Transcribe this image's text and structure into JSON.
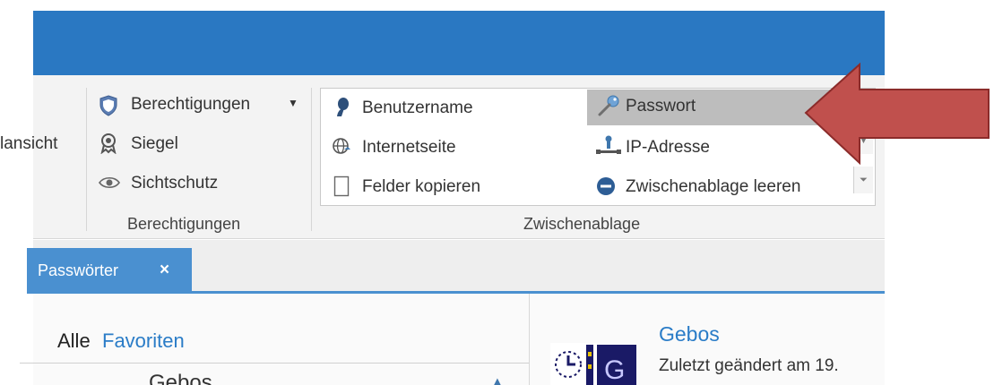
{
  "ribbon": {
    "ansicht_label": "lansicht",
    "berechtigungen_group": {
      "dropdown_label": "Berechtigungen",
      "siegel_label": "Siegel",
      "sichtschutz_label": "Sichtschutz",
      "group_label": "Berechtigungen"
    },
    "zwischenablage_group": {
      "benutzername_label": "Benutzername",
      "passwort_label": "Passwort",
      "internetseite_label": "Internetseite",
      "ip_adresse_label": "IP-Adresse",
      "felder_kopieren_label": "Felder kopieren",
      "zwischenablage_leeren_label": "Zwischenablage leeren",
      "group_label": "Zwischenablage"
    }
  },
  "tabs": [
    {
      "label": "Passwörter",
      "close": "×"
    }
  ],
  "left_pane": {
    "alle_label": "Alle",
    "favoriten_label": "Favoriten",
    "partial_item": "Gebos"
  },
  "detail": {
    "title": "Gebos",
    "subtitle": "Zuletzt geändert am 19."
  },
  "colors": {
    "titlebar": "#2a78c2",
    "tab": "#4a90d0",
    "accent_link": "#2a7cc7",
    "arrow_fill": "#c0504d",
    "arrow_stroke": "#8b2b2a"
  }
}
